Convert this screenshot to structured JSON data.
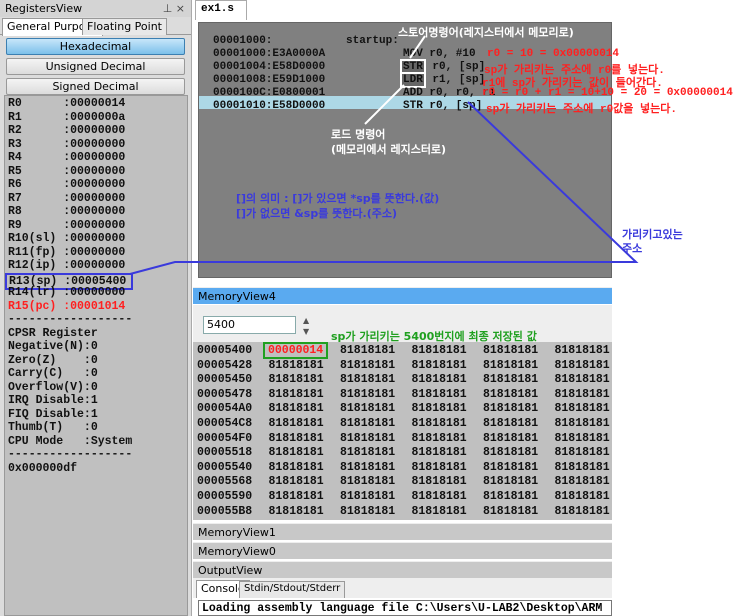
{
  "registers_view": {
    "title": "RegistersView",
    "pin_icon": "pin-icon",
    "close_icon": "close-icon",
    "tabs": [
      "General Purpose",
      "Floating Point"
    ],
    "buttons": [
      "Hexadecimal",
      "Unsigned Decimal",
      "Signed Decimal"
    ],
    "registers": [
      [
        "R0",
        "00000014"
      ],
      [
        "R1",
        "0000000a"
      ],
      [
        "R2",
        "00000000"
      ],
      [
        "R3",
        "00000000"
      ],
      [
        "R4",
        "00000000"
      ],
      [
        "R5",
        "00000000"
      ],
      [
        "R6",
        "00000000"
      ],
      [
        "R7",
        "00000000"
      ],
      [
        "R8",
        "00000000"
      ],
      [
        "R9",
        "00000000"
      ],
      [
        "R10(sl)",
        "00000000"
      ],
      [
        "R11(fp)",
        "00000000"
      ],
      [
        "R12(ip)",
        "00000000"
      ],
      [
        "R13(sp)",
        "00005400"
      ],
      [
        "R14(lr)",
        "00000000"
      ],
      [
        "R15(pc)",
        "00001014"
      ]
    ],
    "separator": "------------------",
    "cpsr_title": "CPSR Register",
    "flags": [
      [
        "Negative(N)",
        "0"
      ],
      [
        "Zero(Z)",
        "0"
      ],
      [
        "Carry(C)",
        "0"
      ],
      [
        "Overflow(V)",
        "0"
      ],
      [
        "IRQ Disable",
        "1"
      ],
      [
        "FIQ Disable",
        "1"
      ],
      [
        "Thumb(T)",
        "0"
      ],
      [
        "CPU Mode",
        "System"
      ]
    ],
    "cpsr_value": "0x000000df"
  },
  "editor": {
    "tab": "ex1.s",
    "lines": [
      {
        "addr": "00001000:",
        "label": "startup:",
        "instr": "",
        "comment": ""
      },
      {
        "addr": "00001000:E3A0000A",
        "instr": "MOV r0, #10",
        "comment": "r0 = 10 = 0x00000014"
      },
      {
        "addr": "00001004:E58D0000",
        "instr": "STR r0, [sp]",
        "comment": "sp가 가리키는 주소에 r0를 넣는다."
      },
      {
        "addr": "00001008:E59D1000",
        "instr": "LDR r1, [sp]",
        "comment": "r1에 sp가 가리키는 값이 들어간다."
      },
      {
        "addr": "0000100C:E0800001",
        "instr": "ADD r0, r0, r1",
        "comment": "r0 = r0 + r1 = 10+10 = 20 = 0x00000014"
      },
      {
        "addr": "00001010:E58D0000",
        "instr": "STR r0, [sp]",
        "comment": "sp가 가리키는 주소에 r0값을 넣는다."
      }
    ],
    "store_note": "스토어명령어(레지스터에서 메모리로)",
    "load_note": [
      "로드 명령어",
      "(메모리에서 레지스터로)"
    ],
    "bracket_note": [
      "[]의 의미 : []가 있으면 *sp를 뜻한다.(값)",
      "[]가 없으면 &sp를 뜻한다.(주소)"
    ],
    "pointing_note": [
      "가리키고있는",
      "주소"
    ]
  },
  "memory_view4": {
    "title": "MemoryView4",
    "address_input": "5400",
    "note": "sp가 가리키는 5400번지에 최종 저장된 값",
    "rows": [
      [
        "00005400",
        "00000014",
        "81818181",
        "81818181",
        "81818181",
        "81818181"
      ],
      [
        "00005428",
        "81818181",
        "81818181",
        "81818181",
        "81818181",
        "81818181"
      ],
      [
        "00005450",
        "81818181",
        "81818181",
        "81818181",
        "81818181",
        "81818181"
      ],
      [
        "00005478",
        "81818181",
        "81818181",
        "81818181",
        "81818181",
        "81818181"
      ],
      [
        "000054A0",
        "81818181",
        "81818181",
        "81818181",
        "81818181",
        "81818181"
      ],
      [
        "000054C8",
        "81818181",
        "81818181",
        "81818181",
        "81818181",
        "81818181"
      ],
      [
        "000054F0",
        "81818181",
        "81818181",
        "81818181",
        "81818181",
        "81818181"
      ],
      [
        "00005518",
        "81818181",
        "81818181",
        "81818181",
        "81818181",
        "81818181"
      ],
      [
        "00005540",
        "81818181",
        "81818181",
        "81818181",
        "81818181",
        "81818181"
      ],
      [
        "00005568",
        "81818181",
        "81818181",
        "81818181",
        "81818181",
        "81818181"
      ],
      [
        "00005590",
        "81818181",
        "81818181",
        "81818181",
        "81818181",
        "81818181"
      ],
      [
        "000055B8",
        "81818181",
        "81818181",
        "81818181",
        "81818181",
        "81818181"
      ]
    ]
  },
  "panels": {
    "memory_view1": "MemoryView1",
    "memory_view0": "MemoryView0",
    "output_view": "OutputView"
  },
  "output": {
    "tabs": [
      "Console",
      "Stdin/Stdout/Stderr"
    ],
    "console_text": "Loading assembly language file C:\\Users\\U-LAB2\\Desktop\\ARM"
  },
  "colors": {
    "red": "#ff2020",
    "annotation_blue": "#3a3adc",
    "note_green": "#20a020",
    "highlight": "#add8e6"
  }
}
